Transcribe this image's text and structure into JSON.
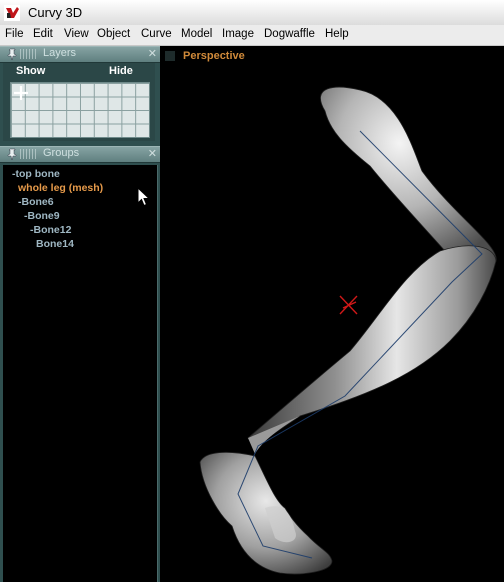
{
  "window": {
    "title": "Curvy 3D"
  },
  "menu": [
    "File",
    "Edit",
    "View",
    "Object",
    "Curve",
    "Model",
    "Image",
    "Dogwaffle",
    "Help"
  ],
  "layers_panel": {
    "title": "Layers",
    "show_label": "Show",
    "hide_label": "Hide"
  },
  "groups_panel": {
    "title": "Groups",
    "items": [
      {
        "label": "-top bone",
        "selected": false
      },
      {
        "label": "whole leg (mesh)",
        "selected": true
      },
      {
        "label": "-Bone6",
        "selected": false
      },
      {
        "label": "-Bone9",
        "selected": false
      },
      {
        "label": "-Bone12",
        "selected": false
      },
      {
        "label": "Bone14",
        "selected": false
      }
    ]
  },
  "viewport": {
    "label": "Perspective"
  },
  "colors": {
    "selected_item": "#e69a4a",
    "tree_text": "#9fb7c3",
    "viewport_label": "#d08a3a",
    "panel_bg": "#2f4f4f"
  }
}
